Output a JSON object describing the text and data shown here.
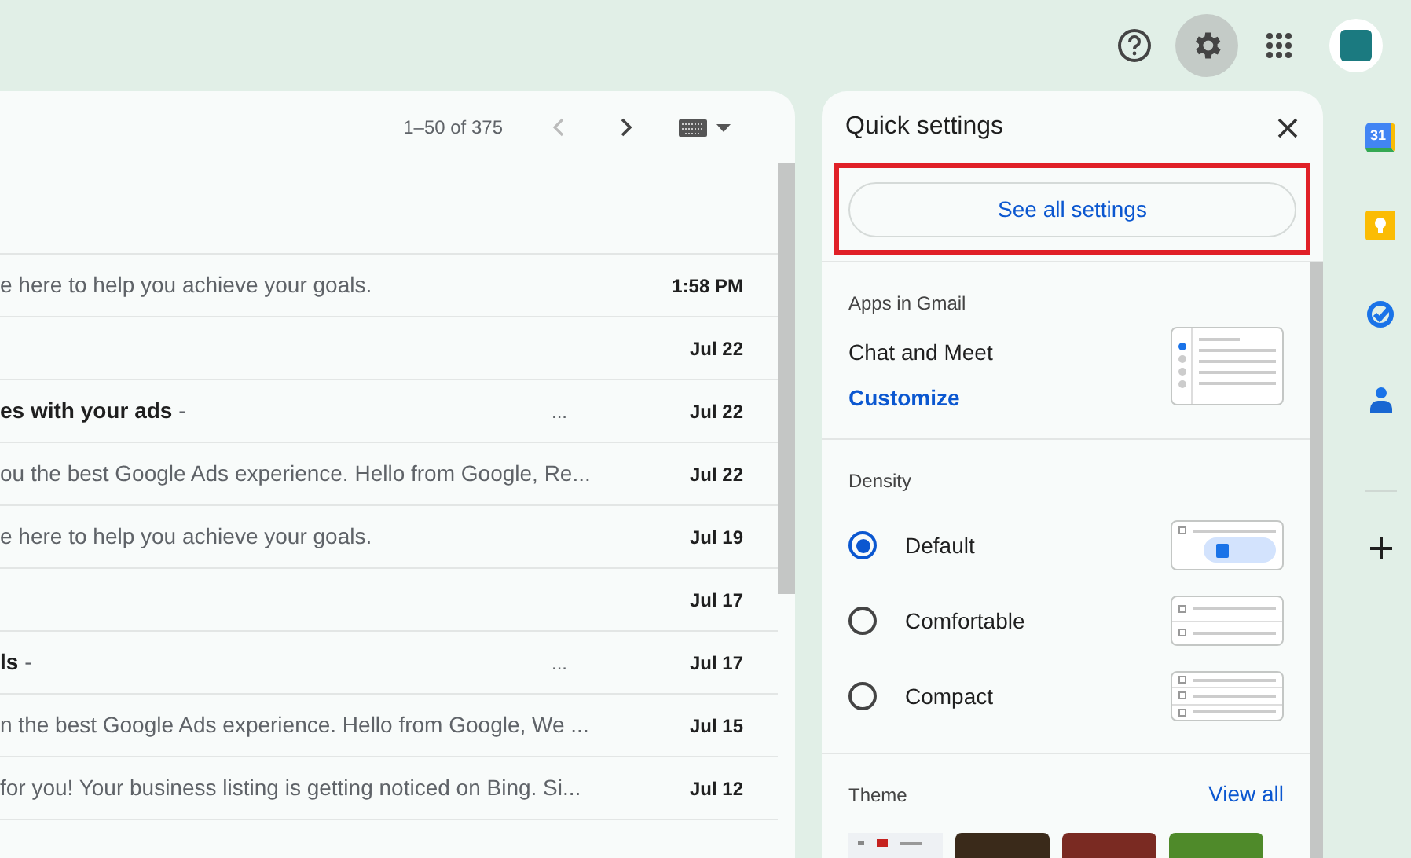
{
  "top_bar": {
    "settings": {
      "selected": true
    }
  },
  "mail_list": {
    "pagination": "1–50 of 375",
    "rows": [
      {
        "snippet": "e here to help you achieve your goals.",
        "date": "1:58 PM"
      },
      {
        "date": "Jul 22"
      },
      {
        "snippet": "**es with your ads** -",
        "more": "...",
        "date": "Jul 22"
      },
      {
        "snippet": "ou the best Google Ads experience. Hello from Google, Re...",
        "date": "Jul 22"
      },
      {
        "snippet": "e here to help you achieve your goals.",
        "date": "Jul 19"
      },
      {
        "date": "Jul 17"
      },
      {
        "snippet": "**ls** -",
        "more": "...",
        "date": "Jul 17"
      },
      {
        "snippet": "n the best Google Ads experience. Hello from Google, We ...",
        "date": "Jul 15"
      },
      {
        "snippet": "for you! Your business listing is getting noticed on Bing. Si...",
        "date": "Jul 12"
      }
    ]
  },
  "quick_settings": {
    "title": "Quick settings",
    "see_all": "See all settings",
    "apps_heading": "Apps in Gmail",
    "apps_label": "Chat and Meet",
    "customize": "Customize",
    "density_heading": "Density",
    "density": [
      {
        "label": "Default",
        "selected": true,
        "kind": "default"
      },
      {
        "label": "Comfortable",
        "selected": false,
        "kind": "comfortable"
      },
      {
        "label": "Compact",
        "selected": false,
        "kind": "compact"
      }
    ],
    "theme_heading": "Theme",
    "view_all": "View all",
    "themes": [
      {
        "kind": "default"
      },
      {
        "kind": "photo",
        "color": "#3a2a1a"
      },
      {
        "kind": "photo",
        "color": "#7a2a22"
      },
      {
        "kind": "photo",
        "color": "#4f8a2a"
      }
    ]
  },
  "side_panel": [
    {
      "kind": "calendar",
      "label": "31"
    },
    {
      "kind": "keep"
    },
    {
      "kind": "tasks"
    },
    {
      "kind": "contacts"
    },
    {
      "kind": "add"
    }
  ]
}
